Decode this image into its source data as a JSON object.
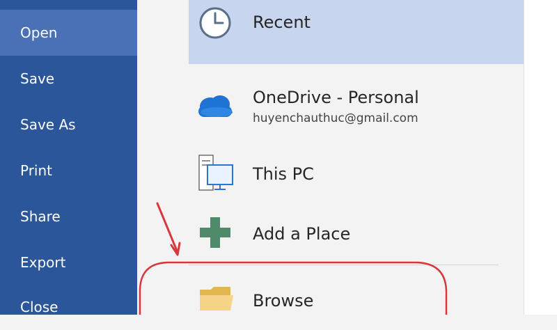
{
  "sidebar": {
    "items": [
      {
        "label": "Open"
      },
      {
        "label": "Save"
      },
      {
        "label": "Save As"
      },
      {
        "label": "Print"
      },
      {
        "label": "Share"
      },
      {
        "label": "Export"
      },
      {
        "label": "Close"
      }
    ],
    "active": "Open"
  },
  "places": {
    "recent": {
      "label": "Recent",
      "icon": "clock-icon"
    },
    "onedrive": {
      "label": "OneDrive - Personal",
      "account": "huyenchauthuc@gmail.com",
      "icon": "cloud-icon"
    },
    "this_pc": {
      "label": "This PC",
      "icon": "computer-icon"
    },
    "add_place": {
      "label": "Add a Place",
      "icon": "plus-icon"
    },
    "browse": {
      "label": "Browse",
      "icon": "folder-icon"
    }
  },
  "colors": {
    "sidebar": "#2b579a",
    "sidebar_active": "#4a71b6",
    "selected_place": "#c7d5ef",
    "annotation": "#d9363e",
    "onedrive": "#1e73d4",
    "add_place": "#4f8a6a",
    "folder": "#f0c76e"
  }
}
